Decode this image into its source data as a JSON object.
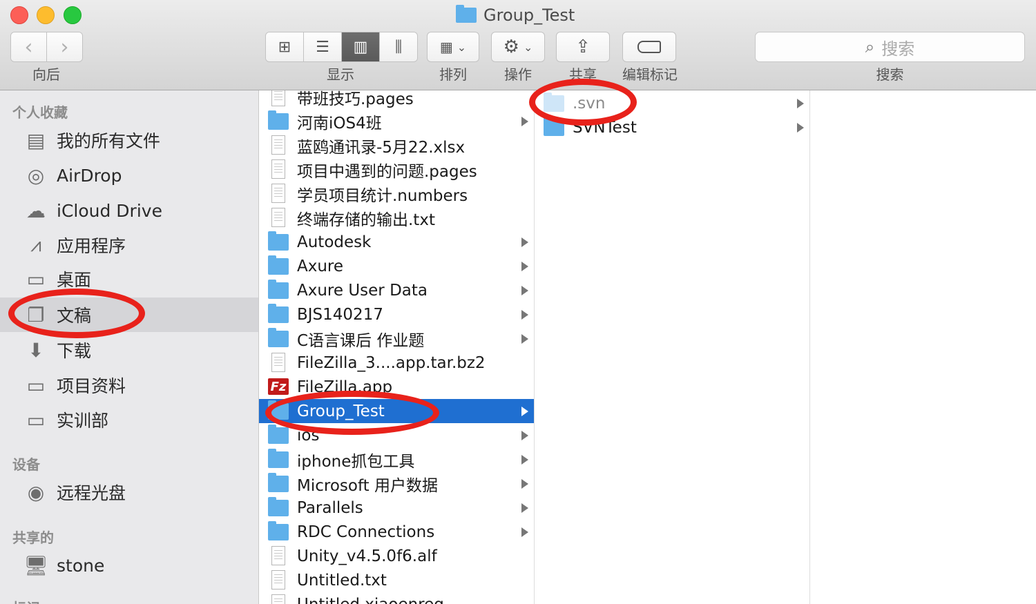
{
  "window": {
    "title": "Group_Test"
  },
  "toolbar": {
    "nav_label": "向后",
    "view_label": "显示",
    "arrange_label": "排列",
    "action_label": "操作",
    "share_label": "共享",
    "tags_label": "编辑标记",
    "search_placeholder": "搜索",
    "search_label": "搜索"
  },
  "sidebar": {
    "favorites_header": "个人收藏",
    "favorites": [
      {
        "label": "我的所有文件",
        "icon": "all-files-icon"
      },
      {
        "label": "AirDrop",
        "icon": "airdrop-icon"
      },
      {
        "label": "iCloud Drive",
        "icon": "cloud-icon"
      },
      {
        "label": "应用程序",
        "icon": "applications-icon"
      },
      {
        "label": "桌面",
        "icon": "desktop-icon"
      },
      {
        "label": "文稿",
        "icon": "documents-icon",
        "selected": true
      },
      {
        "label": "下载",
        "icon": "download-icon"
      },
      {
        "label": "项目资料",
        "icon": "folder-icon"
      },
      {
        "label": "实训部",
        "icon": "folder-icon"
      }
    ],
    "devices_header": "设备",
    "devices": [
      {
        "label": "远程光盘",
        "icon": "disc-icon"
      }
    ],
    "shared_header": "共享的",
    "shared": [
      {
        "label": "stone",
        "icon": "computer-icon"
      }
    ],
    "tags_header": "标记"
  },
  "column1": [
    {
      "name": "带班技巧.pages",
      "type": "doc",
      "arrow": false
    },
    {
      "name": "河南iOS4班",
      "type": "folder",
      "arrow": true
    },
    {
      "name": "蓝鸥通讯录-5月22.xlsx",
      "type": "doc",
      "arrow": false
    },
    {
      "name": "项目中遇到的问题.pages",
      "type": "doc",
      "arrow": false
    },
    {
      "name": "学员项目统计.numbers",
      "type": "doc",
      "arrow": false
    },
    {
      "name": "终端存储的输出.txt",
      "type": "doc",
      "arrow": false
    },
    {
      "name": "Autodesk",
      "type": "folder",
      "arrow": true
    },
    {
      "name": "Axure",
      "type": "folder",
      "arrow": true
    },
    {
      "name": "Axure User Data",
      "type": "folder",
      "arrow": true
    },
    {
      "name": "BJS140217",
      "type": "folder",
      "arrow": true
    },
    {
      "name": "C语言课后 作业题",
      "type": "folder",
      "arrow": true
    },
    {
      "name": "FileZilla_3....app.tar.bz2",
      "type": "doc",
      "arrow": false
    },
    {
      "name": "FileZilla.app",
      "type": "app",
      "arrow": false
    },
    {
      "name": "Group_Test",
      "type": "folder",
      "arrow": true,
      "selected": true
    },
    {
      "name": "ios",
      "type": "folder",
      "arrow": true
    },
    {
      "name": "iphone抓包工具",
      "type": "folder",
      "arrow": true
    },
    {
      "name": "Microsoft 用户数据",
      "type": "folder",
      "arrow": true
    },
    {
      "name": "Parallels",
      "type": "folder",
      "arrow": true
    },
    {
      "name": "RDC Connections",
      "type": "folder",
      "arrow": true
    },
    {
      "name": "Unity_v4.5.0f6.alf",
      "type": "doc",
      "arrow": false
    },
    {
      "name": "Untitled.txt",
      "type": "doc",
      "arrow": false
    },
    {
      "name": "Untitled.xiaoenreg",
      "type": "doc",
      "arrow": false
    }
  ],
  "column2": [
    {
      "name": ".svn",
      "type": "folder-light",
      "arrow": true
    },
    {
      "name": "SVNTest",
      "type": "folder",
      "arrow": true
    }
  ],
  "app_icon_text": "Fz",
  "colors": {
    "selection": "#1f6fd1",
    "folder": "#5fb0ea",
    "annotation": "#e8221b"
  }
}
